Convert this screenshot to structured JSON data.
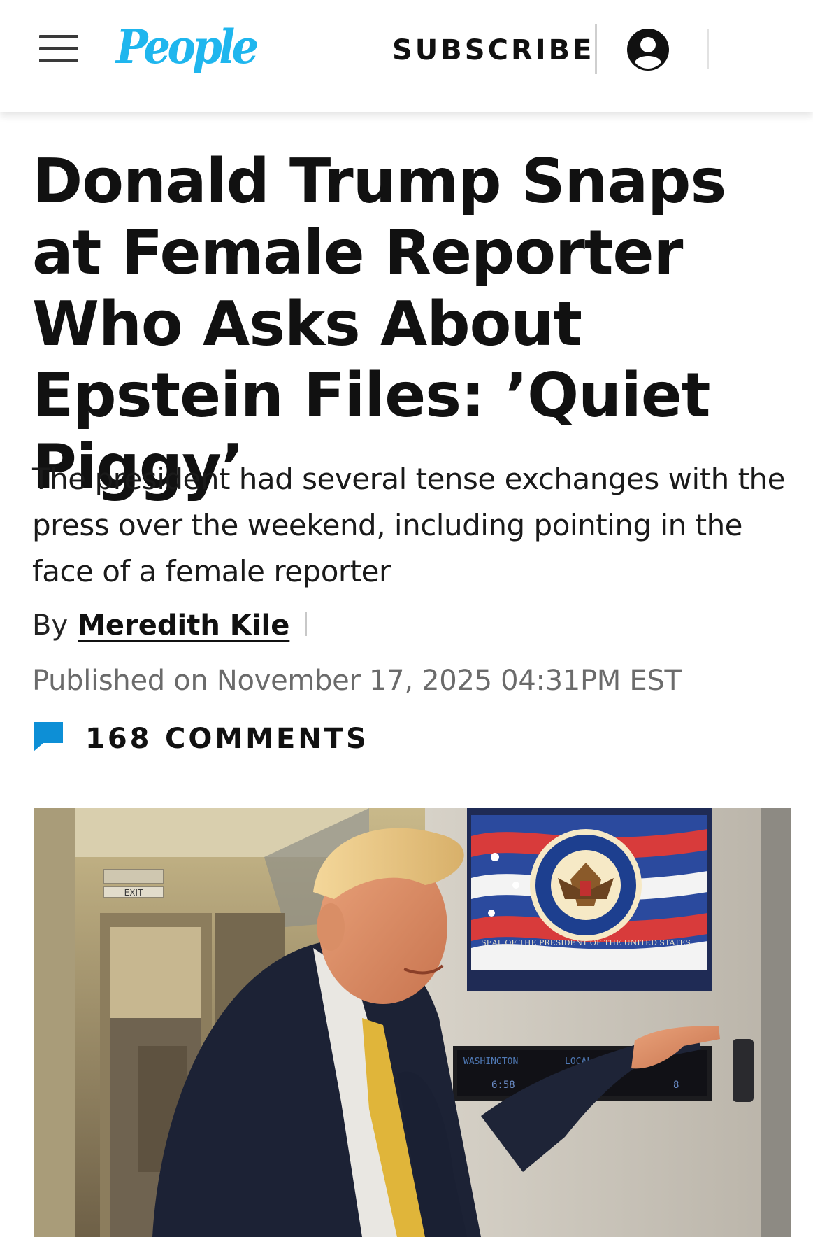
{
  "header": {
    "logo_text": "People",
    "subscribe_label": "SUBSCRIBE",
    "menu_icon": "hamburger-menu-icon",
    "account_icon": "user-account-icon",
    "brand_color": "#1fb6ee"
  },
  "article": {
    "headline": "Donald Trump Snaps at Female Reporter Who Asks About Epstein Files: ’Quiet Piggy’",
    "dek": "The president had several tense exchanges with the press over the weekend, including pointing in the face of a female reporter",
    "byline_prefix": "By",
    "author": "Meredith Kile",
    "published": "Published on November 17, 2025 04:31PM EST",
    "comments_count": "168",
    "comments_label": "COMMENTS",
    "comment_icon": "comment-bubble-icon",
    "accent_color": "#0d8fd6"
  },
  "hero_image": {
    "exit_sign": "EXIT",
    "clock_left": "WASHINGTON",
    "clock_right": "LOCAL",
    "clock_time": "6:58",
    "clock_time_right": "8",
    "seal_text": "SEAL OF THE PRESIDENT OF THE UNITED STATES"
  }
}
